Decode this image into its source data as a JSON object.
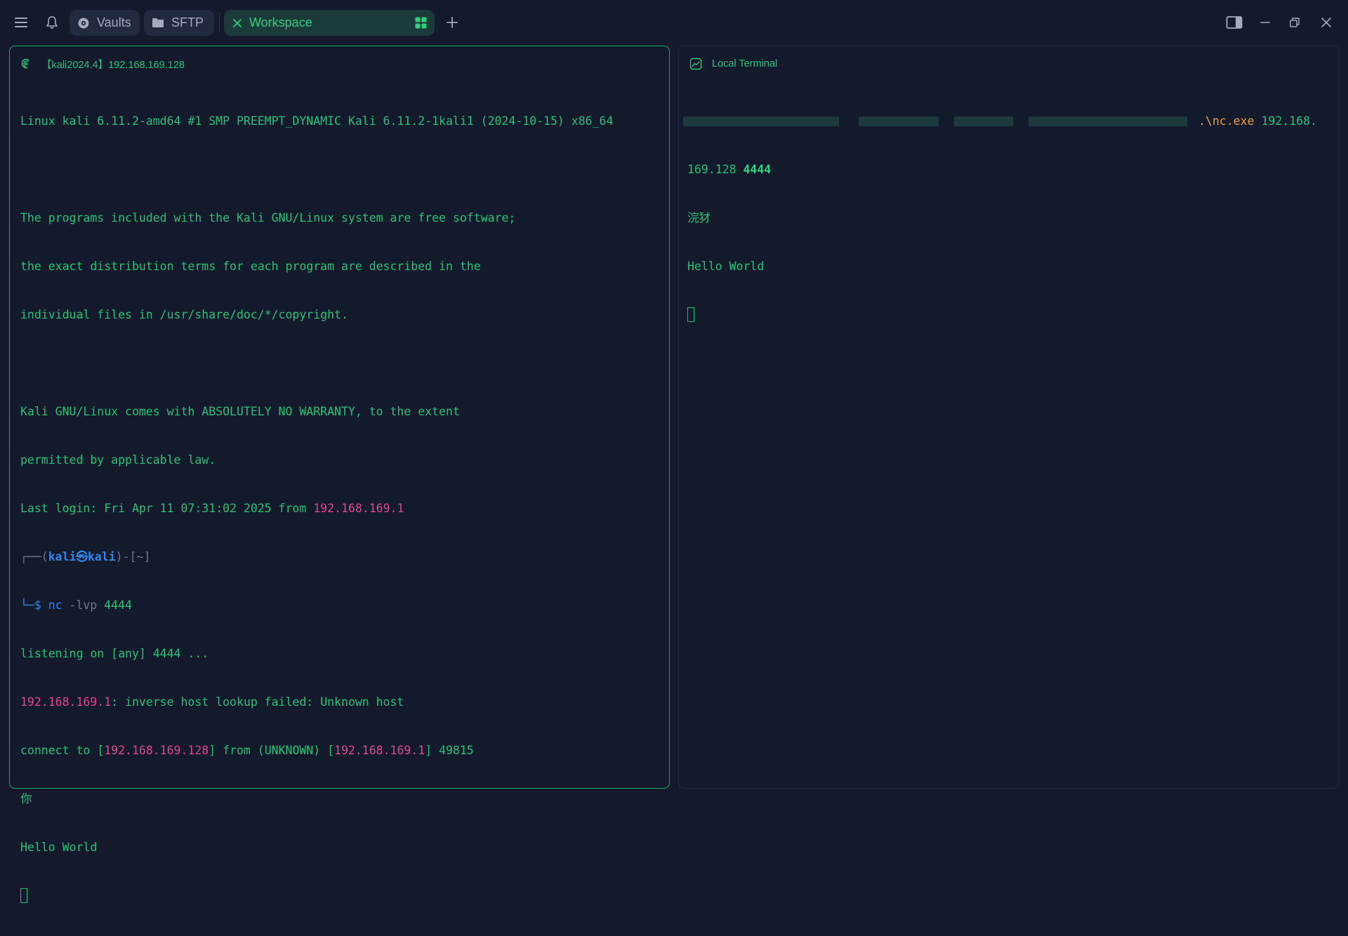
{
  "topbar": {
    "menu_icon": "hamburger-menu-icon",
    "bell_icon": "bell-icon",
    "tabs": [
      {
        "label": "Vaults",
        "icon": "vault-icon"
      },
      {
        "label": "SFTP",
        "icon": "folder-icon"
      },
      {
        "label": "Workspace",
        "icon": "close-icon",
        "active": true
      }
    ],
    "new_tab_icon": "plus-icon",
    "sidebar_toggle_icon": "sidebar-panel-icon",
    "minimize_icon": "minimize-icon",
    "restore_icon": "restore-icon",
    "close_icon": "close-icon"
  },
  "left_pane": {
    "header_icon": "debian-swirl-icon",
    "title": "【kali2024.4】192.168.169.128",
    "lines": {
      "l1": "Linux kali 6.11.2-amd64 #1 SMP PREEMPT_DYNAMIC Kali 6.11.2-1kali1 (2024-10-15) x86_64",
      "l3": "The programs included with the Kali GNU/Linux system are free software;",
      "l4": "the exact distribution terms for each program are described in the",
      "l5": "individual files in /usr/share/doc/*/copyright.",
      "l7": "Kali GNU/Linux comes with ABSOLUTELY NO WARRANTY, to the extent",
      "l8": "permitted by applicable law.",
      "l9_prefix": "Last login: Fri Apr 11 07:31:02 2025 from ",
      "l9_ip": "192.168.169.1",
      "prompt_open": "┌──(",
      "prompt_user": "kali㉿kali",
      "prompt_close": ")-[~]",
      "prompt_dollar": "└─$ ",
      "cmd_name": "nc",
      "cmd_args": " -lvp ",
      "cmd_port": "4444",
      "listen": "listening on [any] 4444 ...",
      "lookup_ip": "192.168.169.1",
      "lookup_rest": ": inverse host lookup failed: Unknown host",
      "connect_a": "connect to [",
      "connect_ip1": "192.168.169.128",
      "connect_b": "] from (UNKNOWN) [",
      "connect_ip2": "192.168.169.1",
      "connect_c": "] 49815",
      "ni": "你",
      "hello": "Hello World"
    }
  },
  "right_pane": {
    "header_icon": "terminal-icon",
    "title": "Local Terminal",
    "cmd_exe": ".\\nc.exe",
    "cmd_ip_part1": " 192.168.",
    "cmd_ip_part2": "169.128 ",
    "cmd_port": "4444",
    "garbled": "浣犲",
    "hello": "Hello World"
  },
  "colors": {
    "background": "#141a2c",
    "terminal_text": "#27c075",
    "ip_highlight": "#e3468d",
    "prompt_blue": "#2f86e8",
    "active_border": "#20a86a",
    "exe_orange": "#ec9f40"
  }
}
